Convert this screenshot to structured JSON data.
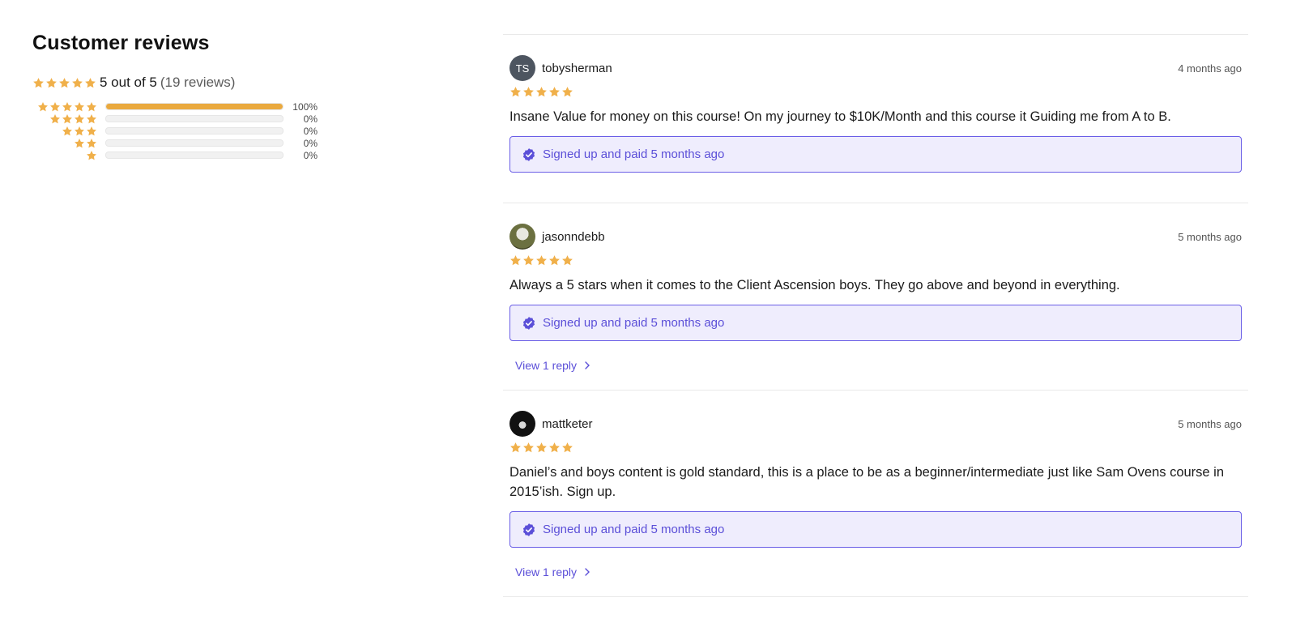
{
  "colors": {
    "star": "#f0b04a",
    "bar_fill": "#eaa93e",
    "accent": "#5b4fd8",
    "verified_bg": "#efedfd"
  },
  "summary": {
    "title": "Customer reviews",
    "rating_text": "5 out of 5",
    "count_text": "(19 reviews)",
    "rating_value": 5,
    "breakdown": [
      {
        "stars": 5,
        "percent": 100,
        "label": "100%"
      },
      {
        "stars": 4,
        "percent": 0,
        "label": "0%"
      },
      {
        "stars": 3,
        "percent": 0,
        "label": "0%"
      },
      {
        "stars": 2,
        "percent": 0,
        "label": "0%"
      },
      {
        "stars": 1,
        "percent": 0,
        "label": "0%"
      }
    ]
  },
  "reviews": [
    {
      "username": "tobysherman",
      "avatar_initials": "TS",
      "time": "4 months ago",
      "rating": 5,
      "text": "Insane Value for money on this course! On my journey to $10K/Month and this course it Guiding me from A to B.",
      "verified_text": "Signed up and paid 5 months ago",
      "reply_text": ""
    },
    {
      "username": "jasonndebb",
      "avatar_initials": "",
      "time": "5 months ago",
      "rating": 5,
      "text": "Always a 5 stars when it comes to the Client Ascension boys. They go above and beyond in everything.",
      "verified_text": "Signed up and paid 5 months ago",
      "reply_text": "View 1 reply"
    },
    {
      "username": "mattketer",
      "avatar_initials": "",
      "time": "5 months ago",
      "rating": 5,
      "text": "Daniel’s and boys content is gold standard, this is a place to be as a beginner/intermediate just like Sam Ovens course in 2015’ish. Sign up.",
      "verified_text": "Signed up and paid 5 months ago",
      "reply_text": "View 1 reply"
    }
  ]
}
